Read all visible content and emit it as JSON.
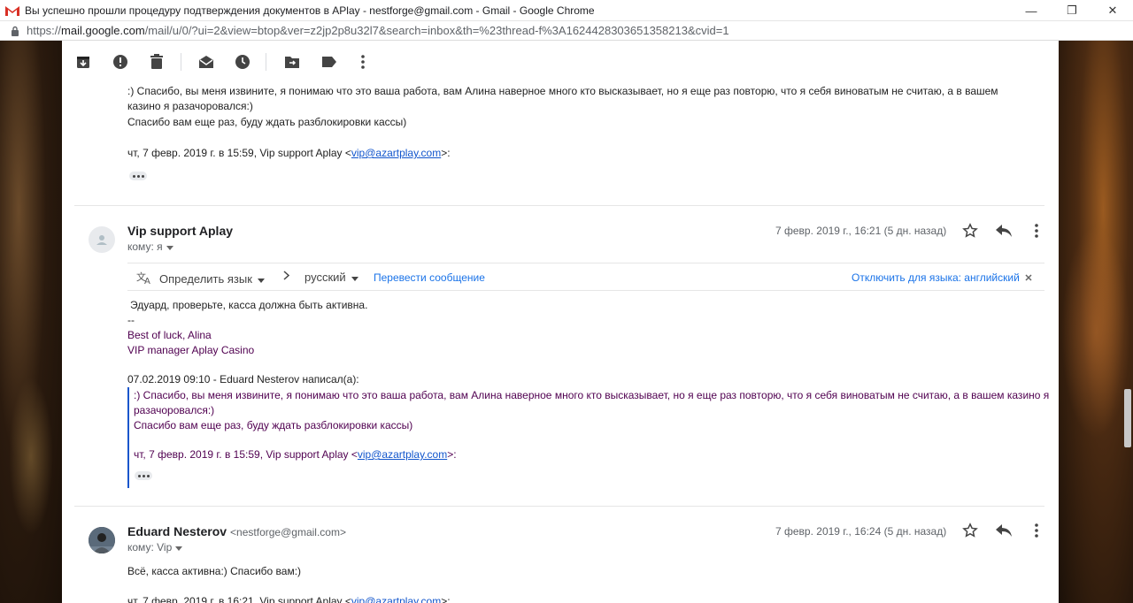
{
  "window": {
    "title": "Вы успешно прошли процедуру подтверждения документов в APlay - nestforge@gmail.com - Gmail - Google Chrome",
    "minimize": "—",
    "restore": "❐",
    "close": "✕"
  },
  "address": {
    "scheme": "https://",
    "host": "mail.google.com",
    "path": "/mail/u/0/?ui=2&view=btop&ver=z2jp2p8u32l7&search=inbox&th=%23thread-f%3A1624428303651358213&cvid=1"
  },
  "toolbar": {
    "icons": [
      "archive-icon",
      "report-spam-icon",
      "delete-icon",
      "mark-unread-icon",
      "snooze-icon",
      "move-to-icon",
      "label-icon",
      "more-vert-icon"
    ]
  },
  "top_quote": {
    "line1": ":) Спасибо, вы меня извините, я понимаю что это ваша работа, вам Алина наверное много кто высказывает, но я еще раз повторю, что я себя виноватым не считаю, а в вашем",
    "line2": "казино я разачоровался:)",
    "line3": "Спасибо вам еще раз, буду ждать разблокировки кассы)",
    "attribution_prefix": "чт, 7 февр. 2019 г. в 15:59, Vip support Aplay <",
    "attribution_link": "vip@azartplay.com",
    "attribution_suffix": ">:"
  },
  "message1": {
    "sender": "Vip support Aplay",
    "to": "кому: я",
    "date": "7 февр. 2019 г., 16:21 (5 дн. назад)",
    "translate": {
      "detect": "Определить язык",
      "target": "русский",
      "translate_link": "Перевести сообщение",
      "disable_link": "Отключить для языка: английский"
    },
    "body": "Эдуард, проверьте, касса должна быть активна.",
    "sig_dash": "--",
    "sig1": "Best of luck, Alina",
    "sig2": "VIP manager Aplay Casino",
    "quote_header": "07.02.2019 09:10 - Eduard Nesterov написал(а):",
    "quote_line1": ":) Спасибо, вы меня извините, я понимаю что это ваша работа, вам Алина наверное много кто высказывает, но я еще раз повторю, что я себя виноватым не считаю, а в вашем казино я",
    "quote_line2": "разачоровался:)",
    "quote_line3": "Спасибо вам еще раз, буду ждать разблокировки кассы)",
    "quote_attr_prefix": "чт, 7 февр. 2019 г. в 15:59, Vip support Aplay <",
    "quote_attr_link": "vip@azartplay.com",
    "quote_attr_suffix": ">:"
  },
  "message2": {
    "sender": "Eduard Nesterov",
    "sender_email": "<nestforge@gmail.com>",
    "to": "кому: Vip",
    "date": "7 февр. 2019 г., 16:24 (5 дн. назад)",
    "body": "Всё, касса активна:) Спасибо вам:)",
    "attr_prefix": "чт, 7 февр. 2019 г. в 16:21, Vip support Aplay <",
    "attr_link": "vip@azartplay.com",
    "attr_suffix": ">:"
  },
  "colors": {
    "gmail_red": "#d93025",
    "link_blue": "#1155cc",
    "quote_purple": "#500050",
    "quote_bar": "#1a56cc"
  }
}
